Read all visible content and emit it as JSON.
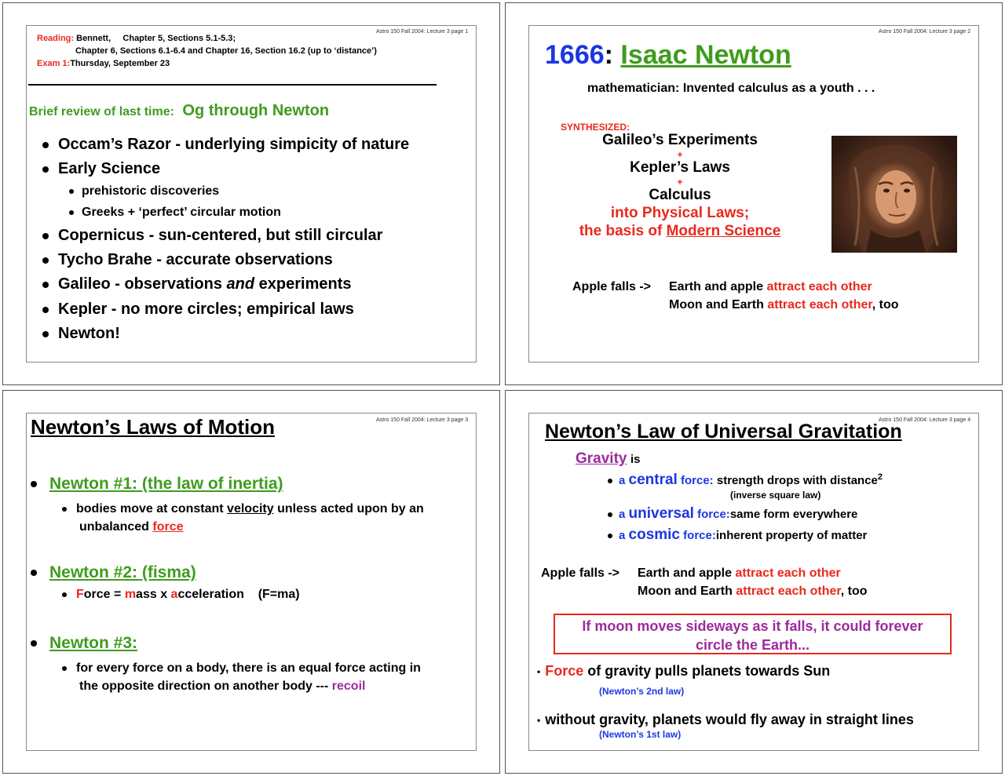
{
  "footer": {
    "p1": "Astro 150 Fall 2004: Lecture 3 page 1",
    "p2": "Astro 150 Fall 2004: Lecture 3 page 2",
    "p3": "Astro 150 Fall 2004: Lecture 3 page 3",
    "p4": "Astro 150 Fall 2004: Lecture 3 page 4"
  },
  "slide1": {
    "reading_label": "Reading:",
    "reading_line1": "Bennett,     Chapter 5, Sections 5.1-5.3;",
    "reading_line2": "Chapter 6, Sections 6.1-6.4 and Chapter 16, Section 16.2 (up to ‘distance’)",
    "exam_label": "Exam 1:",
    "exam_text": "Thursday, September 23",
    "review_label": "Brief review of last time:",
    "review_topic": "Og through Newton",
    "items": [
      "Occam’s Razor - underlying simpicity of nature",
      "Early Science",
      "Copernicus - sun-centered, but still circular",
      "Tycho Brahe - accurate observations",
      "Galileo - observations",
      "Kepler - no more circles; empirical laws",
      "Newton!"
    ],
    "galileo_and": "and",
    "galileo_tail": "experiments",
    "subitems": [
      "prehistoric discoveries",
      "Greeks + ‘perfect’ circular motion"
    ]
  },
  "slide2": {
    "year": "1666",
    "colon": ":",
    "name": "Isaac Newton",
    "subtitle": "mathematician: Invented calculus as a youth . . .",
    "synth_label": "SYNTHESIZED:",
    "synth1": "Galileo’s Experiments",
    "plus": "+",
    "synth2": "Kepler’s Laws",
    "synth3": "Calculus",
    "into": "into Physical Laws;",
    "basis_pre": "the basis of",
    "basis_link": "Modern Science",
    "apple": "Apple falls ->",
    "line1_a": "Earth and apple",
    "line1_b": "attract each other",
    "line2_a": "Moon and Earth",
    "line2_b": "attract each other",
    "line2_c": ", too"
  },
  "slide3": {
    "title": "Newton’s Laws of Motion",
    "law1": "Newton #1: (the law of inertia)",
    "law1_text_a": "bodies move at constant",
    "law1_velocity": "velocity",
    "law1_text_b": "unless acted upon by an",
    "law1_text_c": "unbalanced",
    "law1_force": "force",
    "law2": "Newton #2: (fisma)",
    "law2_f": "F",
    "law2_orce": "orce = ",
    "law2_m": "m",
    "law2_ass": "ass x ",
    "law2_a": "a",
    "law2_cc": "cceleration    (F=ma)",
    "law3": "Newton #3:",
    "law3_text1": "for every force on a body, there is an equal force acting in",
    "law3_text2": "the opposite direction on another body ---",
    "law3_recoil": "recoil"
  },
  "slide4": {
    "title": "Newton’s Law of Universal Gravitation",
    "gravity": "Gravity",
    "is": "is",
    "a": "a",
    "central": "central",
    "central_force": "force:",
    "central_text": "strength drops with distance",
    "sup2": "2",
    "inverse": "(inverse square law)",
    "universal": "universal",
    "universal_force": "force:",
    "universal_text": "same form everywhere",
    "cosmic": "cosmic",
    "cosmic_force": "force:",
    "cosmic_text": "inherent property of matter",
    "apple": "Apple falls ->",
    "line1_a": "Earth and apple",
    "line1_b": "attract each other",
    "line2_a": "Moon and Earth",
    "line2_b": "attract each other",
    "line2_c": ", too",
    "box1": "If moon moves sideways as it falls, it could forever",
    "box2": "circle the Earth...",
    "bullet1_force": "Force",
    "bullet1_text": "of gravity pulls planets towards Sun",
    "bullet1_note": "(Newton’s 2nd law)",
    "bullet2_text": "without gravity, planets would fly away in straight lines",
    "bullet2_note": "(Newton’s 1st law)"
  },
  "colors": {
    "red": "#e8291c",
    "green": "#3f9c1e",
    "blue": "#1c36e0",
    "purple": "#9b2b9c"
  }
}
